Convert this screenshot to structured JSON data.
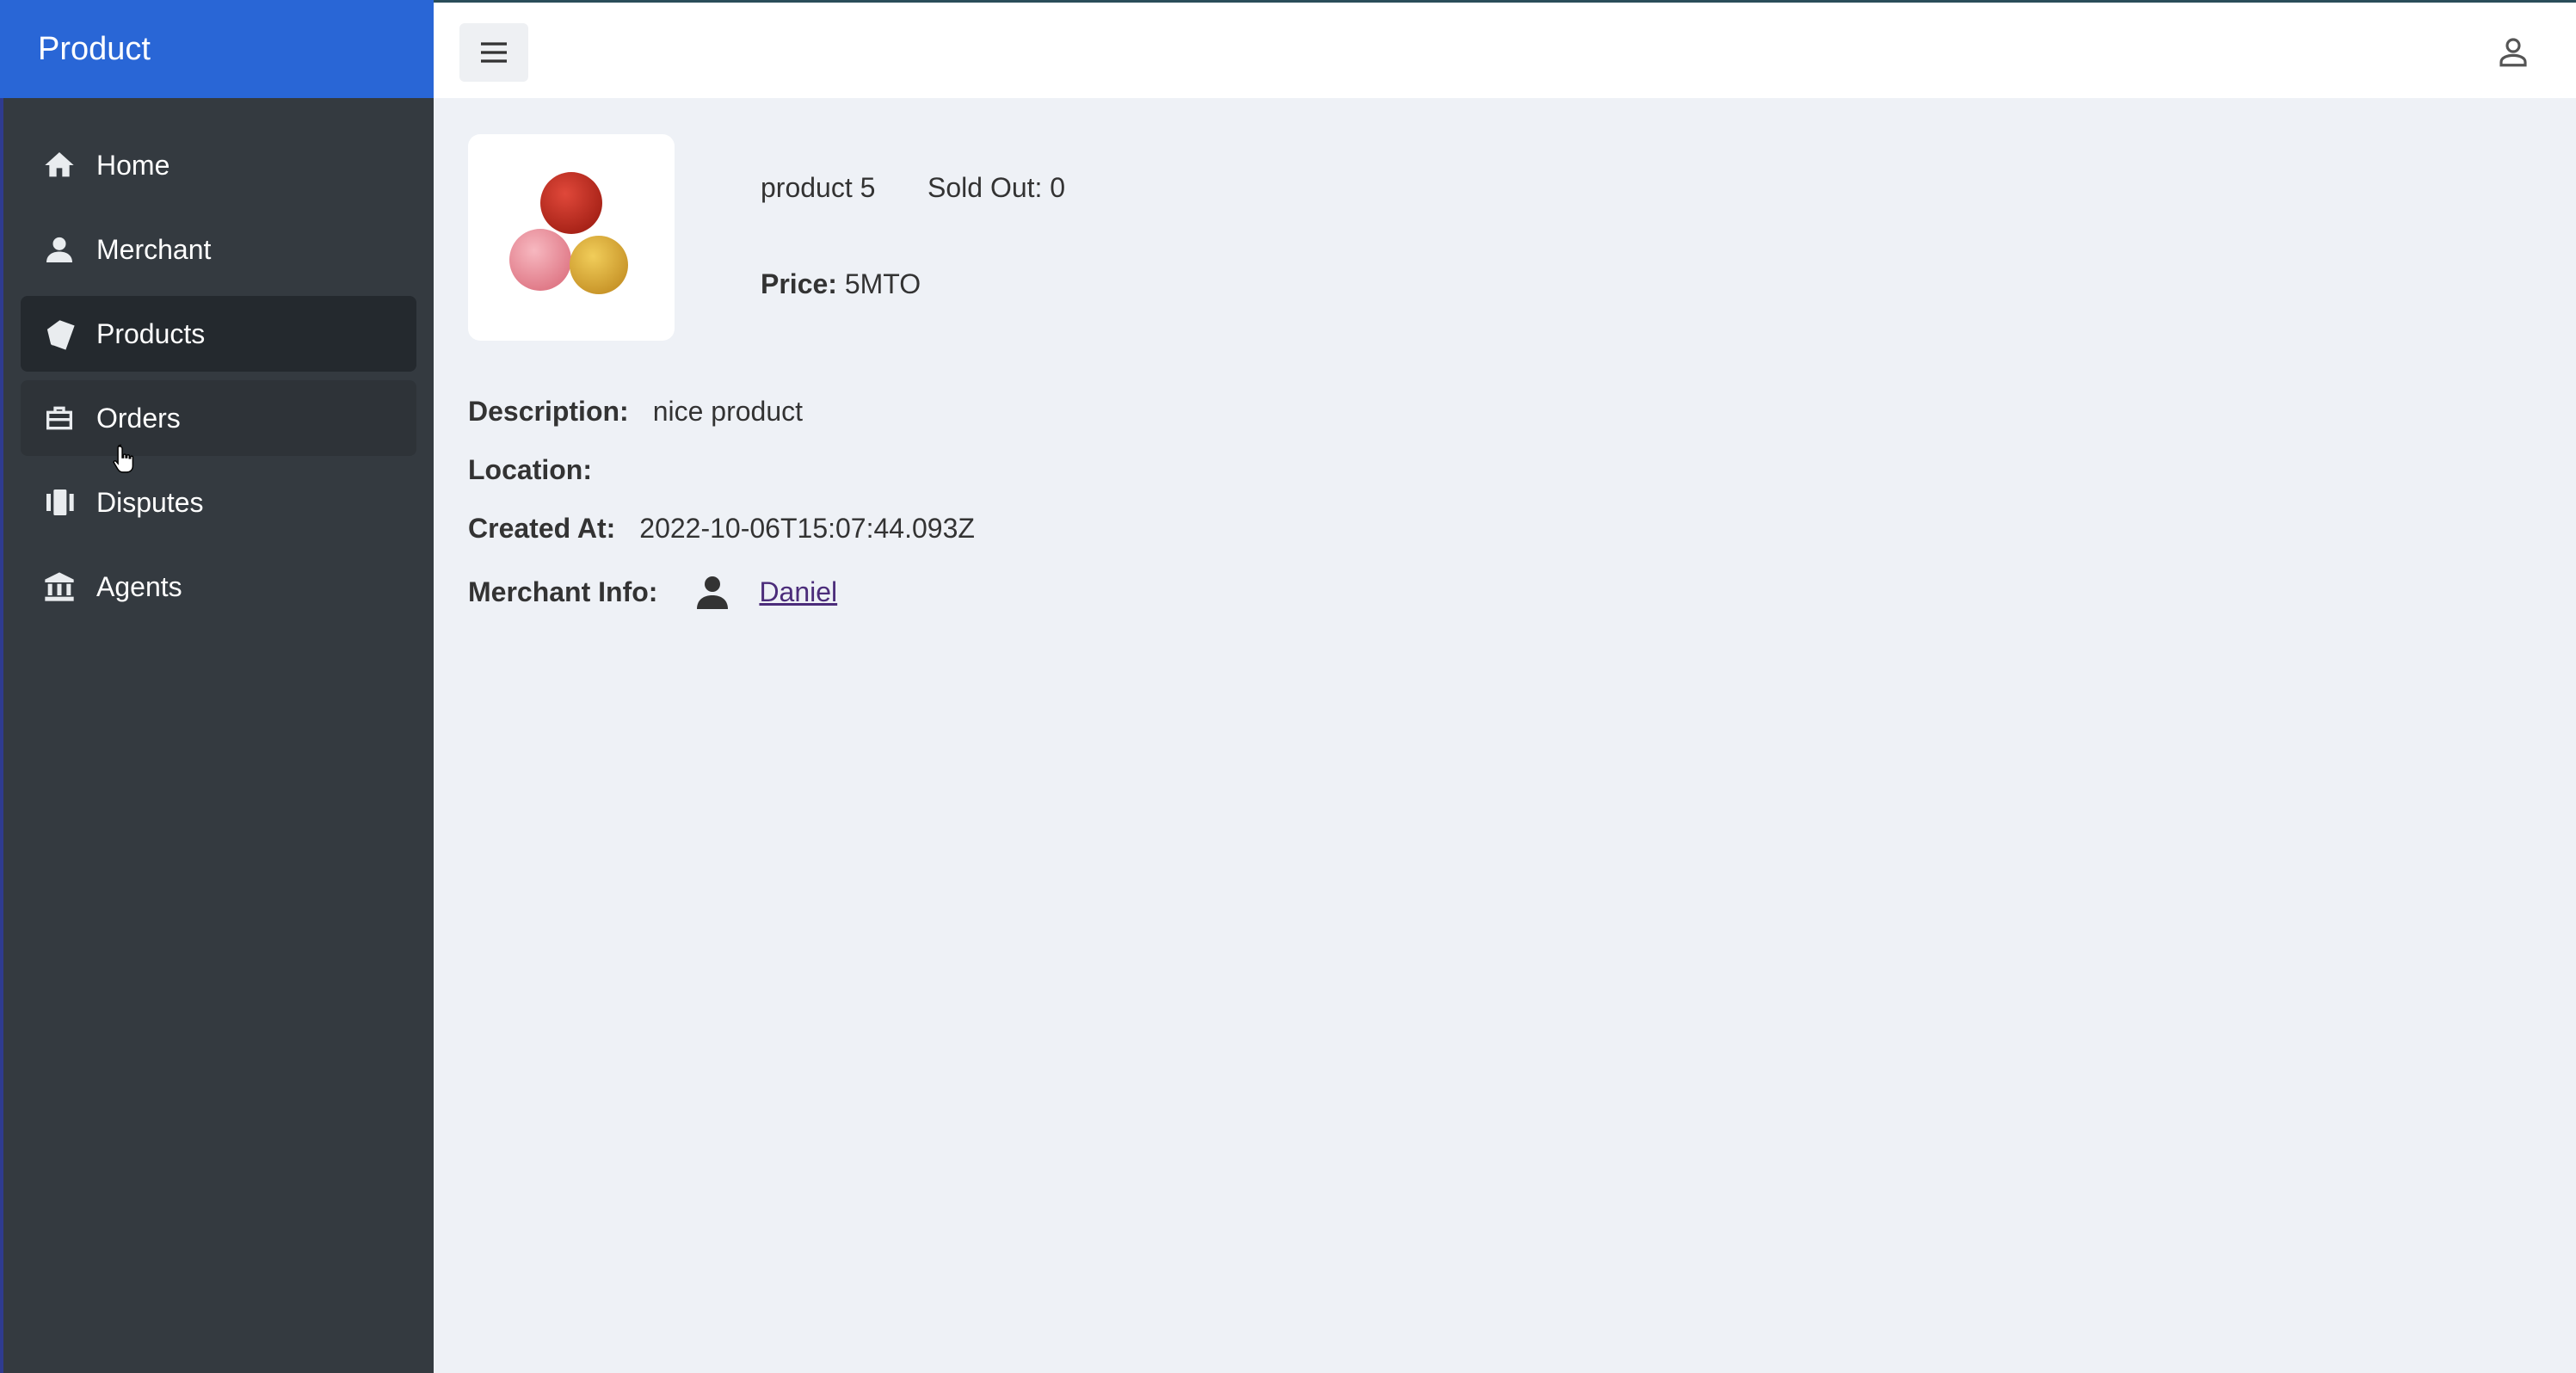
{
  "sidebar": {
    "title": "Product",
    "items": [
      {
        "label": "Home",
        "icon": "home-icon"
      },
      {
        "label": "Merchant",
        "icon": "person-icon"
      },
      {
        "label": "Products",
        "icon": "tags-icon"
      },
      {
        "label": "Orders",
        "icon": "briefcase-icon"
      },
      {
        "label": "Disputes",
        "icon": "cards-icon"
      },
      {
        "label": "Agents",
        "icon": "bank-icon"
      }
    ],
    "active_item": "Products",
    "hovered_item": "Orders"
  },
  "topbar": {
    "menu_icon": "hamburger-menu-icon",
    "user_icon": "user-outline-icon"
  },
  "product": {
    "name": "product 5",
    "sold_out": "Sold Out: 0",
    "price_label": "Price:",
    "price_value": "5MTO",
    "image_icon": "yarn-balls-image",
    "description_label": "Description:",
    "description_value": "nice product",
    "location_label": "Location:",
    "location_value": "",
    "created_label": "Created At:",
    "created_value": "2022-10-06T15:07:44.093Z",
    "merchant_label": "Merchant Info:",
    "merchant_name": "Daniel"
  },
  "colors": {
    "sidebar_bg": "#343a40",
    "brand_bg": "#2966d6",
    "active_item_bg": "#24292e",
    "content_bg": "#eef1f6",
    "link": "#4b2c7a"
  }
}
